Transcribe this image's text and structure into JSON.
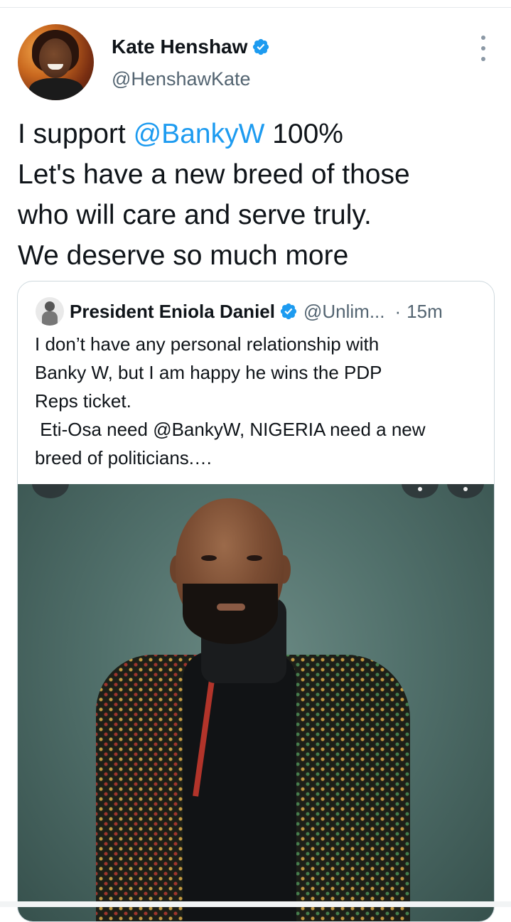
{
  "tweet": {
    "author_name": "Kate Henshaw",
    "author_handle": "@HenshawKate",
    "text_lines": [
      {
        "prefix": "I support ",
        "mention": "@BankyW",
        "suffix": " 100%"
      },
      {
        "text": "Let's have a new breed of those"
      },
      {
        "text": "who will care and serve truly."
      },
      {
        "text": "We deserve so much more"
      }
    ]
  },
  "quoted": {
    "author_name": "President Eniola Daniel",
    "author_handle": "@Unlim...",
    "separator": "·",
    "time": "15m",
    "text_lines": [
      "I don’t have any personal relationship with",
      "Banky W, but I am happy he wins the PDP",
      "Reps ticket.",
      " Eti-Osa need @BankyW, NIGERIA need a new",
      "breed of politicians.…"
    ]
  },
  "colors": {
    "accent": "#1d9bf0",
    "text": "#0f1419",
    "secondary": "#536471",
    "border": "#cfd9de"
  },
  "icons": {
    "verified": "verified-badge-icon",
    "more": "more-vertical-icon"
  }
}
